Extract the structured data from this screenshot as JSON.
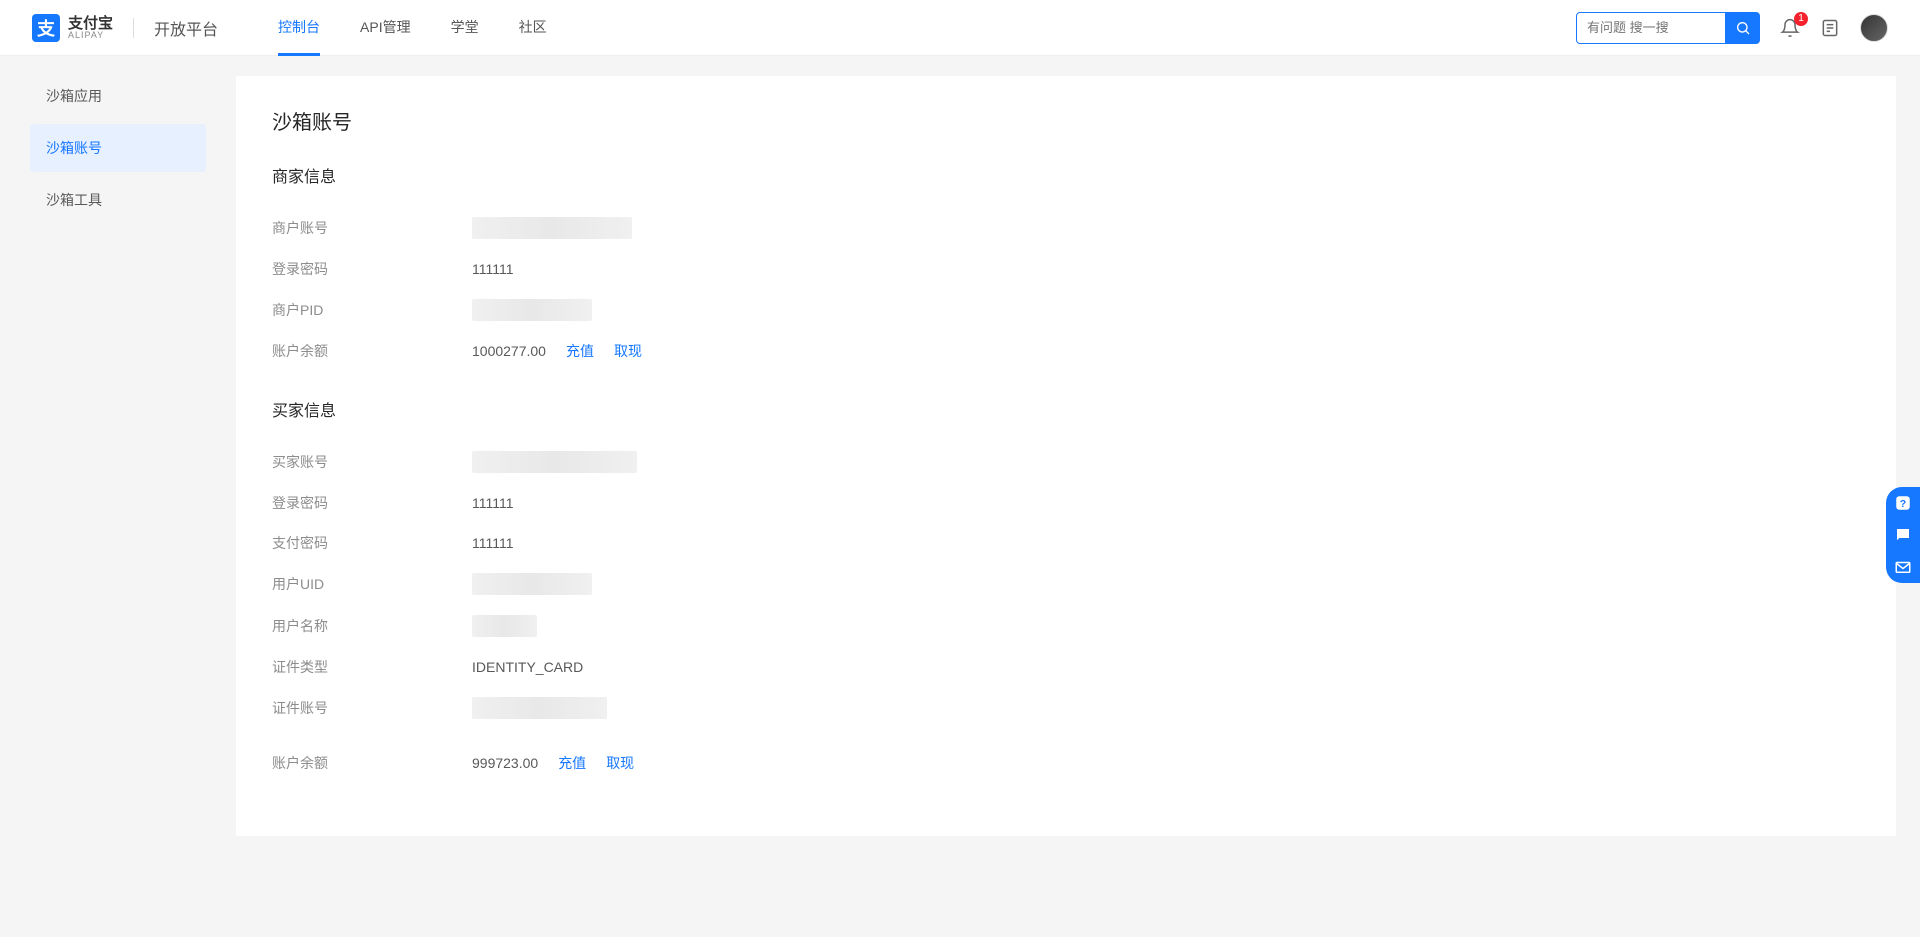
{
  "brand": {
    "cn": "支付宝",
    "en": "ALIPAY",
    "platform": "开放平台"
  },
  "nav": {
    "console": "控制台",
    "api": "API管理",
    "school": "学堂",
    "community": "社区"
  },
  "search": {
    "placeholder": "有问题 搜一搜"
  },
  "notification_count": "1",
  "sidebar": {
    "sandbox_app": "沙箱应用",
    "sandbox_account": "沙箱账号",
    "sandbox_tools": "沙箱工具"
  },
  "page": {
    "title": "沙箱账号",
    "merchant_section": "商家信息",
    "buyer_section": "买家信息",
    "labels": {
      "merchant_account": "商户账号",
      "login_password": "登录密码",
      "merchant_pid": "商户PID",
      "balance": "账户余额",
      "buyer_account": "买家账号",
      "pay_password": "支付密码",
      "user_uid": "用户UID",
      "user_name": "用户名称",
      "cert_type": "证件类型",
      "cert_number": "证件账号"
    },
    "merchant": {
      "login_password": "111111",
      "balance": "1000277.00"
    },
    "buyer": {
      "login_password": "111111",
      "pay_password": "111111",
      "cert_type": "IDENTITY_CARD",
      "balance": "999723.00"
    },
    "actions": {
      "recharge": "充值",
      "withdraw": "取现"
    }
  }
}
